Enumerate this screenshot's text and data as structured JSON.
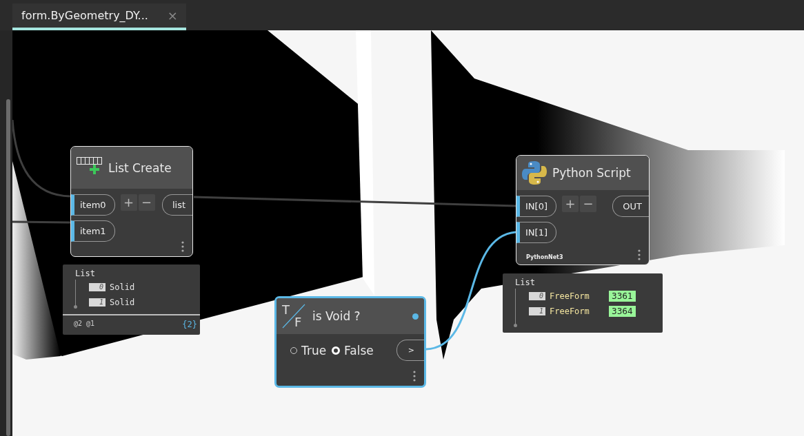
{
  "tab": {
    "title": "form.ByGeometry_DY...",
    "close": "×",
    "selected": true
  },
  "nodes": [
    {
      "kind": "list-create",
      "title": "List Create",
      "selected": false,
      "inputs": [
        "item0",
        "item1"
      ],
      "add": "+",
      "remove": "−",
      "output": "list",
      "preview": {
        "title": "List",
        "items": [
          {
            "index": "0",
            "value": "Solid"
          },
          {
            "index": "1",
            "value": "Solid"
          }
        ],
        "levels": "@2 @1",
        "count": "{2}"
      }
    },
    {
      "kind": "python",
      "title": "Python Script",
      "selected": false,
      "inputs": [
        "IN[0]",
        "IN[1]"
      ],
      "add": "+",
      "remove": "−",
      "output": "OUT",
      "engine": "PythonNet3",
      "preview": {
        "title": "List",
        "items": [
          {
            "index": "0",
            "value": "FreeForm",
            "id": "3361"
          },
          {
            "index": "1",
            "value": "FreeForm",
            "id": "3364"
          }
        ]
      }
    },
    {
      "kind": "boolean",
      "title": "is Void ?",
      "selected": true,
      "icon_letters": [
        "T",
        "F"
      ],
      "output": ">",
      "options": [
        {
          "label": "True",
          "selected": false
        },
        {
          "label": "False",
          "selected": true
        }
      ]
    }
  ]
}
